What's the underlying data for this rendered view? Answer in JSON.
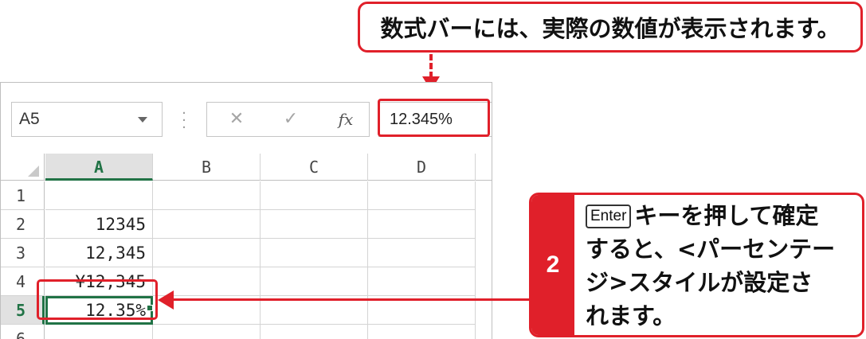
{
  "callout_top": {
    "text": "数式バーには、実際の数値が表示されます。"
  },
  "formula_bar": {
    "name_box": "A5",
    "cancel_glyph": "✕",
    "enter_glyph": "✓",
    "fx_label": "fx",
    "value": "12.345%"
  },
  "sheet": {
    "columns": [
      "A",
      "B",
      "C",
      "D"
    ],
    "rows": [
      {
        "num": "1",
        "a": ""
      },
      {
        "num": "2",
        "a": "12345"
      },
      {
        "num": "3",
        "a": "12,345"
      },
      {
        "num": "4",
        "a": "¥12,345"
      },
      {
        "num": "5",
        "a": "12.35%"
      },
      {
        "num": "6",
        "a": ""
      }
    ],
    "active_cell": "A5"
  },
  "step": {
    "number": "2",
    "key_label": "Enter",
    "line1": "キーを押して確定",
    "line2": "すると、<パーセンテー",
    "line3": "ジ>スタイルが設定さ",
    "line4": "れます。"
  },
  "colors": {
    "accent_red": "#e0202a",
    "excel_green": "#217346"
  }
}
